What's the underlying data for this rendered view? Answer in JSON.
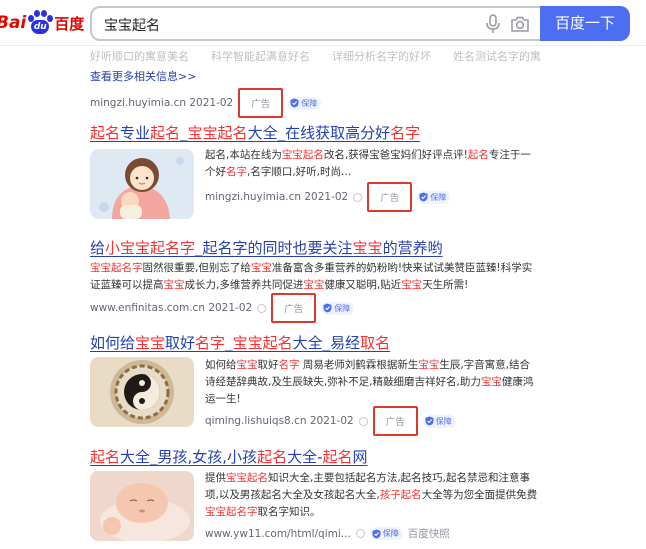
{
  "header": {
    "logo_text_left": "Bai",
    "logo_paw_text": "du",
    "logo_text_right": "百度",
    "query": "宝宝起名",
    "search_button": "百度一下"
  },
  "top_block": {
    "faded_items": [
      "好听顺口的寓意美名",
      "科学智能起满意好名",
      "详细分析名字的好坏",
      "姓名测试名字的寓意"
    ],
    "more_link": "查看更多相关信息>>",
    "url": "mingzi.huyimia.cn  2021-02",
    "ad_label": "广告",
    "guard_label": "保障"
  },
  "results": [
    {
      "title_parts": [
        [
          "起名",
          true
        ],
        [
          "专业",
          false
        ],
        [
          "起名",
          true
        ],
        [
          "_",
          false
        ],
        [
          "宝宝起名",
          true
        ],
        [
          "大全_在线获取高分好",
          false
        ],
        [
          "名字",
          true
        ]
      ],
      "desc_parts": [
        [
          "起名,本站在线为",
          false
        ],
        [
          "宝宝起名",
          true
        ],
        [
          "改名,获得宝爸宝妈们好评点评!",
          false
        ],
        [
          "起名",
          true
        ],
        [
          "专注于一个好",
          false
        ],
        [
          "名字",
          true
        ],
        [
          ",名字顺口,好听,时尚...",
          false
        ]
      ],
      "url": "mingzi.huyimia.cn  2021-02",
      "ad_label": "广告",
      "guard_label": "保障"
    },
    {
      "title_parts": [
        [
          "给",
          false
        ],
        [
          "小宝宝起名字",
          true
        ],
        [
          "_起名字的同时也要关注",
          false
        ],
        [
          "宝宝",
          true
        ],
        [
          "的营养哟",
          false
        ]
      ],
      "desc_parts": [
        [
          "宝宝起名字",
          true
        ],
        [
          "固然很重要,但别忘了给",
          false
        ],
        [
          "宝宝",
          true
        ],
        [
          "准备富含多重营养的奶粉哟!快来试试美赞臣蓝臻!科学实证蓝臻可以提高",
          false
        ],
        [
          "宝宝",
          true
        ],
        [
          "成长力,多维营养共同促进",
          false
        ],
        [
          "宝宝",
          true
        ],
        [
          "健康又聪明,贴近",
          false
        ],
        [
          "宝宝",
          true
        ],
        [
          "天生所需!",
          false
        ]
      ],
      "url": "www.enfinitas.com.cn  2021-02",
      "ad_label": "广告",
      "guard_label": "保障"
    },
    {
      "title_parts": [
        [
          "如何给",
          false
        ],
        [
          "宝宝",
          true
        ],
        [
          "取好",
          false
        ],
        [
          "名字",
          true
        ],
        [
          "_",
          false
        ],
        [
          "宝宝起名",
          true
        ],
        [
          "大全_易经",
          false
        ],
        [
          "取名",
          true
        ]
      ],
      "desc_parts": [
        [
          "如何给",
          false
        ],
        [
          "宝宝",
          true
        ],
        [
          "取好",
          false
        ],
        [
          "名字",
          true
        ],
        [
          " 周易老师刘鹤霖根据新生",
          false
        ],
        [
          "宝宝",
          true
        ],
        [
          "生辰,字音寓意,结合诗经楚辞典故,及生辰缺失,弥补不足,精敲细磨吉祥好名,助力",
          false
        ],
        [
          "宝宝",
          true
        ],
        [
          "健康鸿运一生!",
          false
        ]
      ],
      "url": "qiming.lishuiqs8.cn  2021-02",
      "ad_label": "广告",
      "guard_label": "保障"
    },
    {
      "title_parts": [
        [
          "起名",
          true
        ],
        [
          "大全_男孩,女孩,小孩",
          false
        ],
        [
          "起名",
          true
        ],
        [
          "大全-",
          false
        ],
        [
          "起名",
          true
        ],
        [
          "网",
          false
        ]
      ],
      "desc_parts": [
        [
          "提供",
          false
        ],
        [
          "宝宝起名",
          true
        ],
        [
          "知识大全,主要包括起名方法,起名技巧,起名禁忌和注意事项,以及男孩起名大全及女孩起名大全,",
          false
        ],
        [
          "孩子起名",
          true
        ],
        [
          "大全等为您全面提供免费",
          false
        ],
        [
          "宝宝起名字",
          true
        ],
        [
          "取名字知识。",
          false
        ]
      ],
      "url": "www.yw11.com/html/qimi...",
      "guard_label": "保障",
      "kuaizhao": "百度快照"
    }
  ]
}
